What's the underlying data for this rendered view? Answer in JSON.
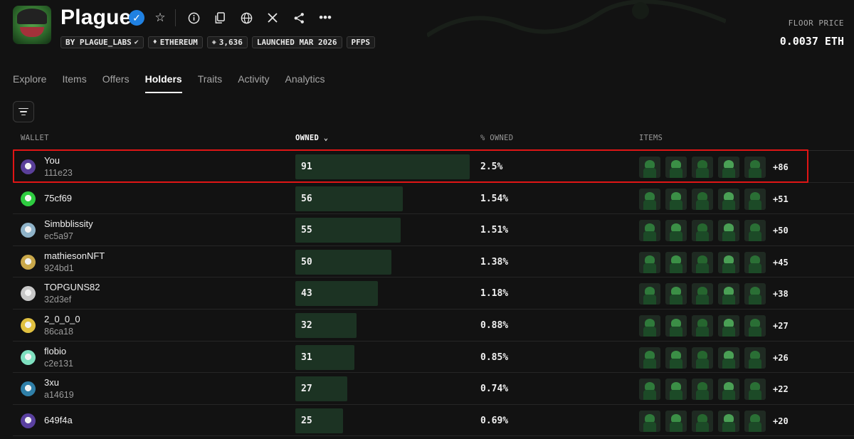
{
  "collection": {
    "title": "Plague",
    "chips": [
      {
        "icon": "verified-icon",
        "label": "BY PLAGUE_LABS"
      },
      {
        "icon": "ethereum-icon",
        "label": "ETHEREUM"
      },
      {
        "icon": "layers-icon",
        "label": "3,636"
      },
      {
        "icon": "",
        "label": "LAUNCHED MAR 2026"
      },
      {
        "icon": "",
        "label": "PFPS"
      }
    ],
    "floor_label": "FLOOR PRICE",
    "floor_value": "0.0037 ETH"
  },
  "header_icons": [
    "star-icon",
    "info-icon",
    "copy-icon",
    "globe-icon",
    "x-icon",
    "share-icon",
    "more-icon"
  ],
  "tabs": [
    {
      "label": "Explore",
      "active": false
    },
    {
      "label": "Items",
      "active": false
    },
    {
      "label": "Offers",
      "active": false
    },
    {
      "label": "Holders",
      "active": true
    },
    {
      "label": "Traits",
      "active": false
    },
    {
      "label": "Activity",
      "active": false
    },
    {
      "label": "Analytics",
      "active": false
    }
  ],
  "table": {
    "headers": {
      "wallet": "WALLET",
      "owned": "OWNED",
      "pct_owned": "% OWNED",
      "items": "ITEMS"
    },
    "rows": [
      {
        "name": "You",
        "address": "111e23",
        "owned": 91,
        "owned_label": "91",
        "pct": "2.5%",
        "more": "+86",
        "avatar_color": "#5a3f9a"
      },
      {
        "name": "75cf69",
        "address": "",
        "owned": 56,
        "owned_label": "56",
        "pct": "1.54%",
        "more": "+51",
        "avatar_color": "#2ecc40"
      },
      {
        "name": "Simbblissity",
        "address": "ec5a97",
        "owned": 55,
        "owned_label": "55",
        "pct": "1.51%",
        "more": "+50",
        "avatar_color": "#8fb3c9"
      },
      {
        "name": "mathiesonNFT",
        "address": "924bd1",
        "owned": 50,
        "owned_label": "50",
        "pct": "1.38%",
        "more": "+45",
        "avatar_color": "#c9a84a"
      },
      {
        "name": "TOPGUNS82",
        "address": "32d3ef",
        "owned": 43,
        "owned_label": "43",
        "pct": "1.18%",
        "more": "+38",
        "avatar_color": "#c8c8c8"
      },
      {
        "name": "2_0_0_0",
        "address": "86ca18",
        "owned": 32,
        "owned_label": "32",
        "pct": "0.88%",
        "more": "+27",
        "avatar_color": "#e0c040"
      },
      {
        "name": "flobio",
        "address": "c2e131",
        "owned": 31,
        "owned_label": "31",
        "pct": "0.85%",
        "more": "+26",
        "avatar_color": "#7fe0c0"
      },
      {
        "name": "3xu",
        "address": "a14619",
        "owned": 27,
        "owned_label": "27",
        "pct": "0.74%",
        "more": "+22",
        "avatar_color": "#2f7fa8"
      },
      {
        "name": "649f4a",
        "address": "",
        "owned": 25,
        "owned_label": "25",
        "pct": "0.69%",
        "more": "+20",
        "avatar_color": "#5a40a0"
      }
    ]
  }
}
